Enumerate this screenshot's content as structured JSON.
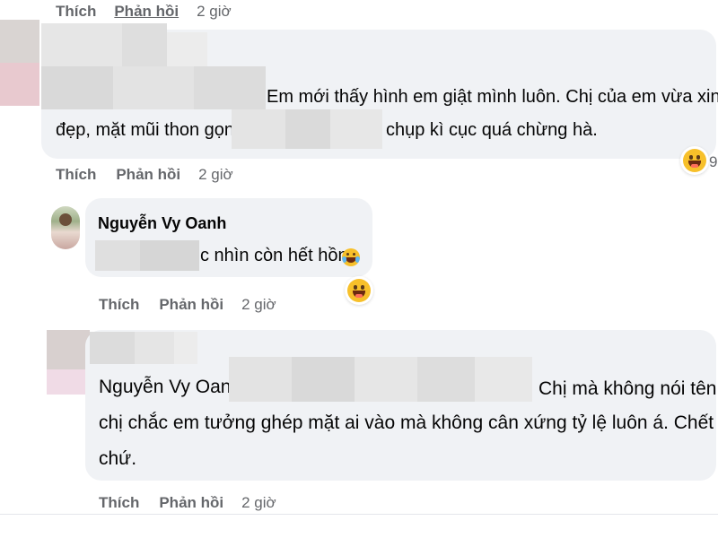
{
  "actions_top": {
    "like": "Thích",
    "reply": "Phản hồi",
    "time": "2 giờ"
  },
  "comment1": {
    "line1": "Em mới thấy hình em giật mình luôn. Chị của em vừa xinh",
    "line2a": "đẹp, mặt mũi thon gọn.",
    "line2b": "chụp kì cục quá chừng hà.",
    "reaction_count": "9",
    "reaction_icon": "grinning-face-emoji"
  },
  "actions1": {
    "like": "Thích",
    "reply": "Phản hồi",
    "time": "2 giờ"
  },
  "comment2": {
    "author": "Nguyễn Vy Oanh",
    "text": "c nhìn còn hết hồn",
    "inline_icon": "laughing-tears-emoji",
    "reaction_icon": "grinning-face-emoji"
  },
  "actions2": {
    "like": "Thích",
    "reply": "Phản hồi",
    "time": "2 giờ"
  },
  "comment3": {
    "tag": "Nguyễn Vy Oanh",
    "line1": "Chị mà không nói tên",
    "line2": "chị chắc em tưởng ghép mặt ai vào mà không cân xứng tỷ lệ luôn á. Chết thật",
    "line3": "chứ."
  },
  "actions3": {
    "like": "Thích",
    "reply": "Phản hồi",
    "time": "2 giờ"
  },
  "colors": {
    "bubble": "#f0f2f5",
    "meta": "#65676b",
    "text": "#050505",
    "emoji": "#f7c02a"
  }
}
